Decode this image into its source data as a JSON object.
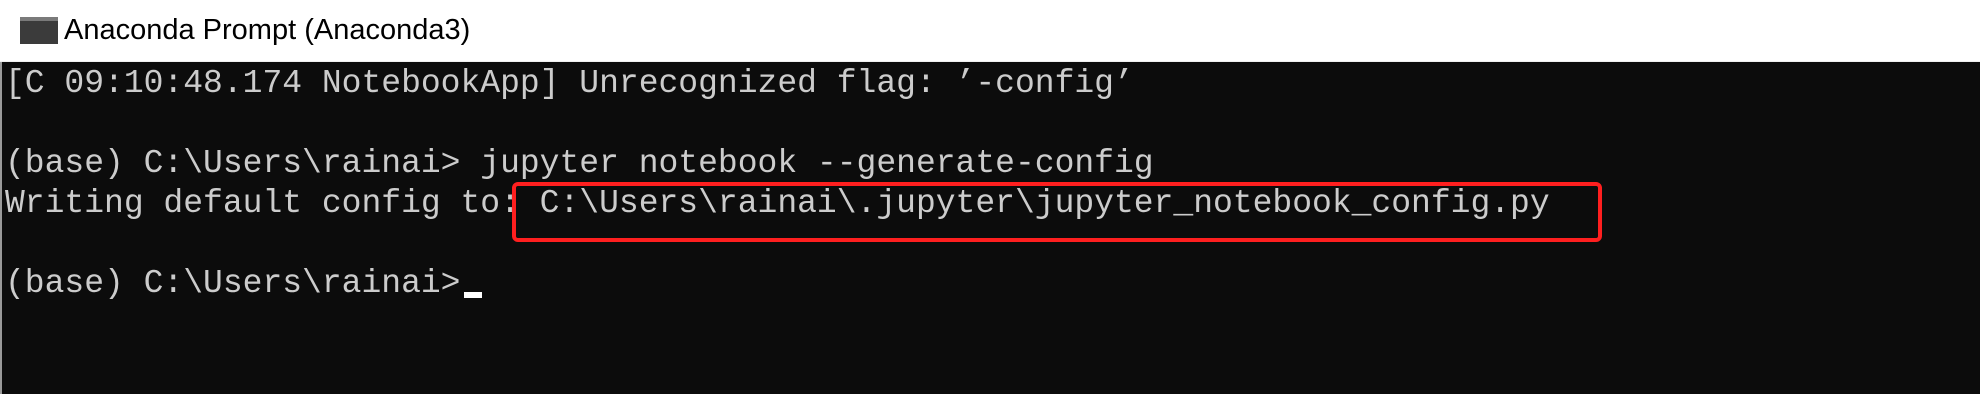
{
  "window": {
    "title": "Anaconda Prompt (Anaconda3)",
    "icon": "console-icon"
  },
  "console": {
    "lines": [
      "[C 09:10:48.174 NotebookApp] Unrecognized flag: ’-config’",
      "(base) C:\\Users\\rainai> jupyter notebook --generate-config",
      "Writing default config to: C:\\Users\\rainai\\.jupyter\\jupyter_notebook_config.py",
      "(base) C:\\Users\\rainai>"
    ]
  },
  "colors": {
    "console_background": "#0c0c0c",
    "console_text": "#cccccc",
    "highlight_border": "#ff1f1f"
  }
}
